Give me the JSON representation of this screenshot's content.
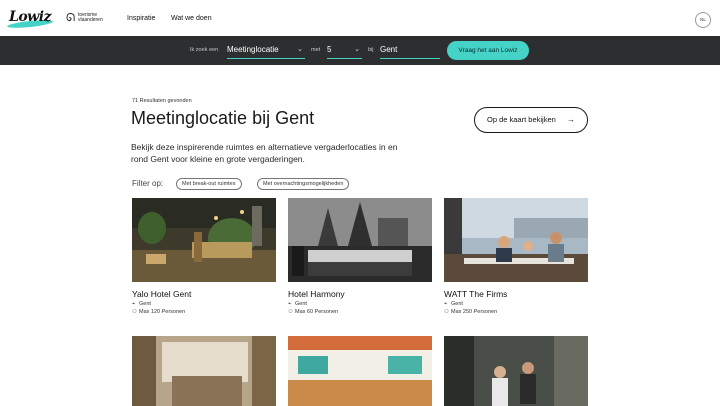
{
  "nav": {
    "logo_text": "Lowiz",
    "partner_line1": "toerisme",
    "partner_line2": "vlaanderen",
    "links": [
      "Inspiratie",
      "Wat we doen"
    ],
    "language": "NL"
  },
  "search": {
    "prefix_label": "Ik zoek een",
    "type_value": "Meetinglocatie",
    "with_label": "met",
    "count_value": "5",
    "at_label": "bij",
    "city_value": "Gent",
    "cta_label": "Vraag het aan Lowiz",
    "accent_color": "#45d3c8"
  },
  "results": {
    "count_text": "71 Resultaten gevonden",
    "title_main": "Meetinglocatie",
    "title_city": "bij Gent",
    "map_button": "Op de kaart bekijken",
    "description": "Bekijk deze inspirerende ruimtes en alternatieve vergaderlocaties in en rond Gent voor kleine en grote vergaderingen.",
    "filter_label": "Filter op:",
    "filters": [
      "Met break-out ruimtes",
      "Met overnachtingsmogelijkheden"
    ]
  },
  "cards": [
    {
      "name": "Yalo Hotel Gent",
      "location": "Gent",
      "capacity": "Max 120 Personen"
    },
    {
      "name": "Hotel Harmony",
      "location": "Gent",
      "capacity": "Max 60 Personen"
    },
    {
      "name": "WATT The Firms",
      "location": "Gent",
      "capacity": "Max 250 Personen"
    },
    {
      "name": "",
      "location": "",
      "capacity": ""
    },
    {
      "name": "",
      "location": "",
      "capacity": ""
    },
    {
      "name": "",
      "location": "",
      "capacity": ""
    }
  ]
}
